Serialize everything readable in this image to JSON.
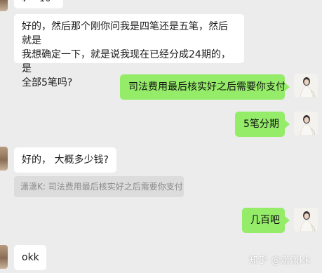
{
  "messages": {
    "top_partial": "10",
    "m1_line1": "好的，然后那个刚你问我是四笔还是五笔，然后就是",
    "m1_line2": "我想确定一下，就是说我现在已经分成24期的，是",
    "m1_line3": "全部5笔吗?",
    "m2": "司法费用最后核实好之后需要你支付",
    "m3": "5笔分期",
    "m4": "好的， 大概多少钱?",
    "m4_quote": "潇潇K: 司法费用最后核实好之后需要你支付",
    "m5": "几百吧",
    "m6": "okk"
  },
  "watermark": "知乎 @潇潇kk",
  "colors": {
    "background": "#ececec",
    "incoming_bubble": "#ffffff",
    "outgoing_bubble": "#95ec69",
    "quote_bg": "#dcdcdc"
  },
  "icons": {
    "voice": "voice-wave-icon"
  }
}
